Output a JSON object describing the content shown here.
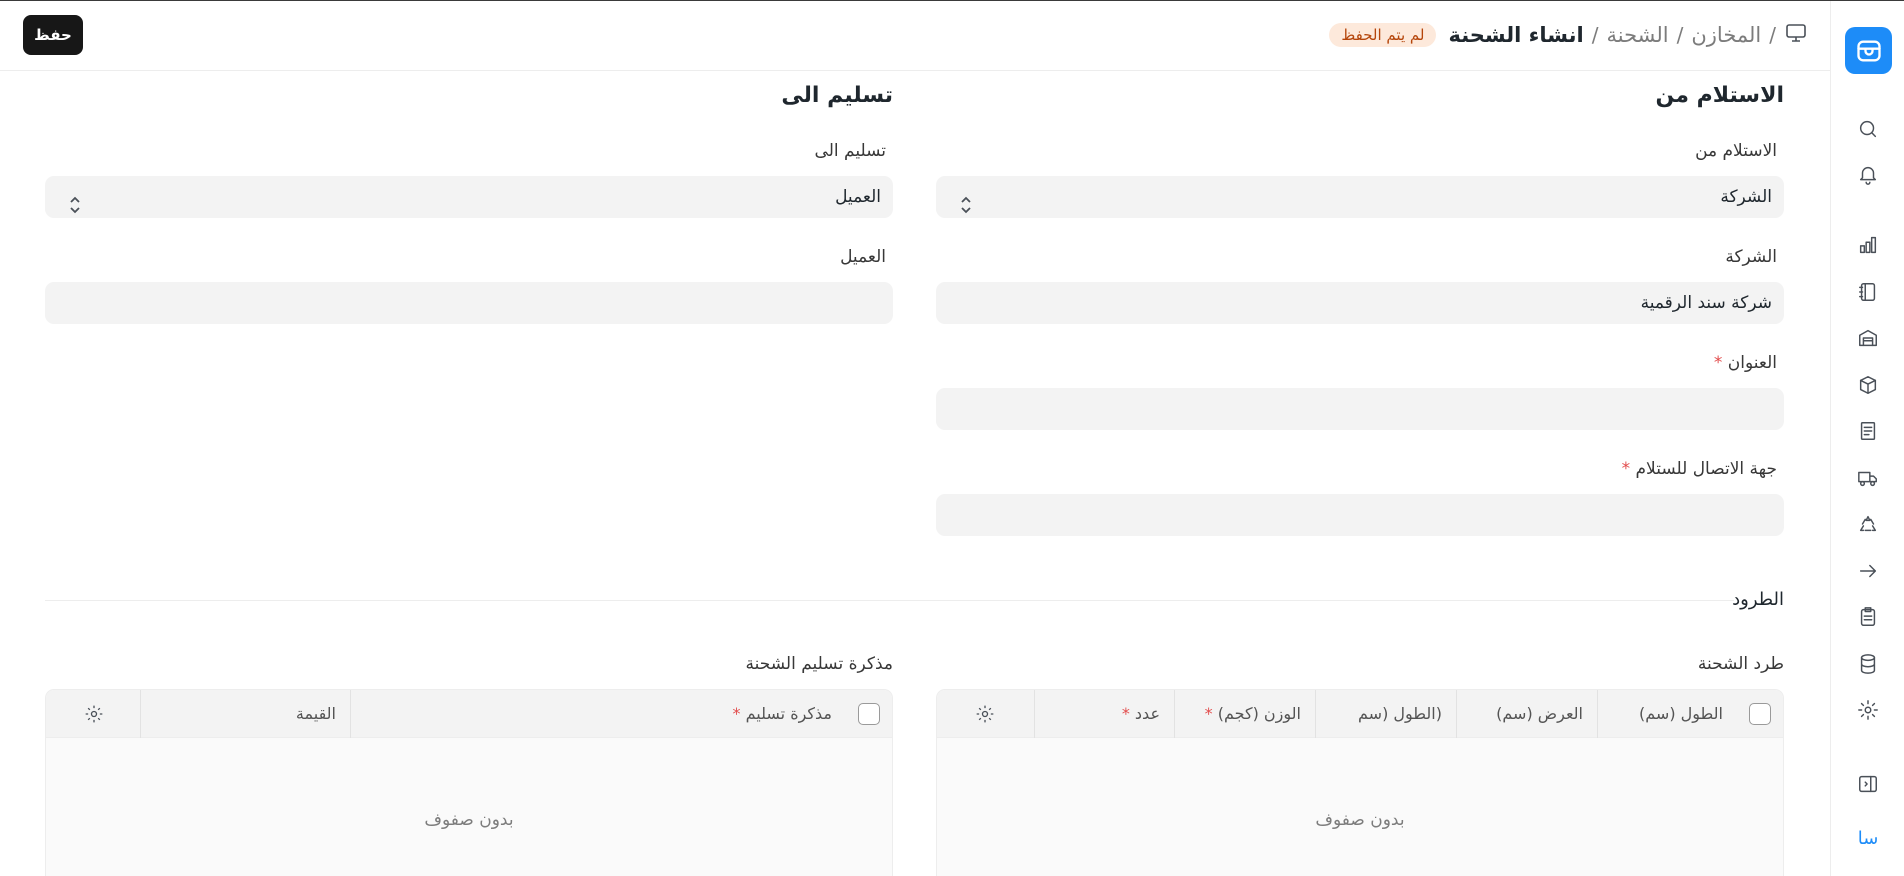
{
  "header": {
    "save_label": "حفظ",
    "breadcrumb": [
      "المخازن",
      "الشحنة"
    ],
    "current": "انشاء الشحنة",
    "status": "لم يتم الحفظ",
    "separator": "/"
  },
  "sidebar": {
    "avatar": "سا",
    "icons": [
      "search-icon",
      "bell-icon",
      "chart-icon",
      "notebook-icon",
      "warehouse-icon",
      "box-icon",
      "receipt-icon",
      "truck-icon",
      "recycle-icon",
      "arrow-right-icon",
      "clipboard-icon",
      "database-icon",
      "gear-icon",
      "sidebar-toggle-icon"
    ],
    "accent": "#1d8cf8"
  },
  "pickup": {
    "section_title": "الاستلام من",
    "from_label": "الاستلام من",
    "from_value": "الشركة",
    "company_label": "الشركة",
    "company_value": "شركة سند الرقمية",
    "address_label": "العنوان",
    "contact_label": "جهة الاتصال للستلام",
    "required_mark": "*"
  },
  "delivery": {
    "section_title": "تسليم الى",
    "to_label": "تسليم الى",
    "to_value": "العميل",
    "customer_label": "العميل",
    "customer_value": ""
  },
  "parcels": {
    "section_title": "الطرود",
    "parcel_table": {
      "title": "طرد الشحنة",
      "columns": [
        "الطول (سم)",
        "العرض (سم)",
        "(الطول (سم",
        "الوزن (كجم)",
        "عدد"
      ],
      "empty": "بدون صفوف"
    },
    "note_table": {
      "title": "مذكرة تسليم الشحنة",
      "columns": [
        "مذكرة تسليم",
        "القيمة"
      ],
      "empty": "بدون صفوف"
    }
  }
}
